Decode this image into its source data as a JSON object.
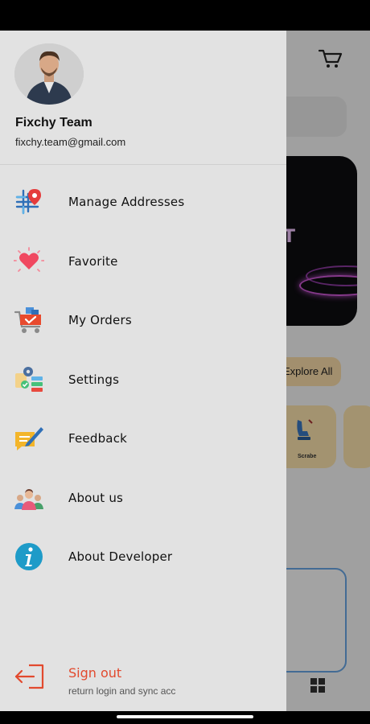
{
  "profile": {
    "name": "Fixchy Team",
    "email": "fixchy.team@gmail.com"
  },
  "menu": {
    "items": [
      {
        "label": "Manage Addresses",
        "icon": "address-pin-icon"
      },
      {
        "label": "Favorite",
        "icon": "heart-icon"
      },
      {
        "label": "My Orders",
        "icon": "cart-icon"
      },
      {
        "label": "Settings",
        "icon": "settings-gear-icon"
      },
      {
        "label": "Feedback",
        "icon": "feedback-pencil-icon"
      },
      {
        "label": "About us",
        "icon": "team-people-icon"
      },
      {
        "label": "About Developer",
        "icon": "info-icon"
      }
    ]
  },
  "signout": {
    "label": "Sign out",
    "subtitle": "return login and sync acc",
    "icon": "logout-icon"
  },
  "background": {
    "explore_label": "Explore All",
    "category_label": "Scrabe",
    "banner_text": "T"
  },
  "colors": {
    "drawer_bg": "#e2e2e2",
    "signout": "#e24a2e",
    "accent_blue": "#2f6fb7"
  }
}
